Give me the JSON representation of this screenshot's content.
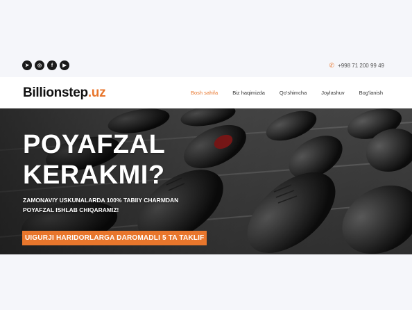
{
  "topbar": {
    "socials": [
      {
        "name": "telegram-icon",
        "glyph": "➤"
      },
      {
        "name": "instagram-icon",
        "glyph": "◎"
      },
      {
        "name": "facebook-icon",
        "glyph": "f"
      },
      {
        "name": "youtube-icon",
        "glyph": "▶"
      }
    ],
    "phone": "+998 71 200 99 49"
  },
  "header": {
    "logo_main": "Billionstep",
    "logo_accent": ".uz",
    "nav": [
      "Bosh sahifa",
      "Biz haqimizda",
      "Qo'shimcha",
      "Joylashuv",
      "Bog'lanish"
    ]
  },
  "hero": {
    "title_line1": "POYAFZAL",
    "title_line2": "KERAKMI?",
    "sub_line1": "ZAMONAVIY USKUNALARDA 100% TABIIY CHARMDAN",
    "sub_line2": "POYAFZAL ISHLAB CHIQARAMIZ!",
    "cta": "UIGURJI HARIDORLARGA DAROMADLI 5 TA TAKLIF"
  },
  "colors": {
    "accent": "#e8762c",
    "dark": "#1a1a1a"
  }
}
